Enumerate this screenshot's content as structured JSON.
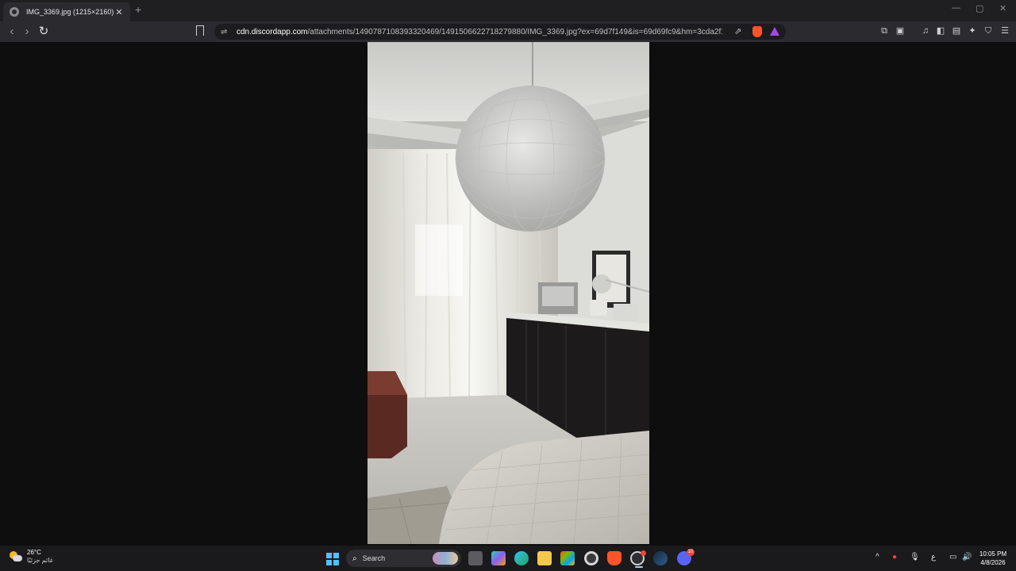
{
  "tab": {
    "title": "IMG_3369.jpg (1215×2160)",
    "close": "✕",
    "new_tab": "+"
  },
  "window": {
    "minimize": "—",
    "maximize": "▢",
    "close": "✕"
  },
  "nav": {
    "back": "‹",
    "forward": "›",
    "reload": "↻"
  },
  "address": {
    "host": "cdn.discordapp.com",
    "path": "/attachments/1490787108393320469/1491506622718279880/IMG_3369.jpg?ex=69d7f149&is=69d69fc9&hm=3cda2f13d3a51cb..."
  },
  "image": {
    "alt": "IMG_3369.jpg"
  },
  "weather": {
    "temp": "26°C",
    "condition": "غائم جزئيًا"
  },
  "taskbar": {
    "search_label": "Search",
    "apps": [
      "file-explorer",
      "copilot",
      "edge",
      "folder",
      "store",
      "settings",
      "brave",
      "chrome",
      "steam",
      "discord"
    ],
    "discord_badge": "10",
    "language": "ع"
  },
  "clock": {
    "time": "10:05 PM",
    "date": "4/8/2026"
  },
  "colors": {
    "accent": "#4cc2ff",
    "brave": "#fb542b",
    "discord": "#5865f2"
  }
}
